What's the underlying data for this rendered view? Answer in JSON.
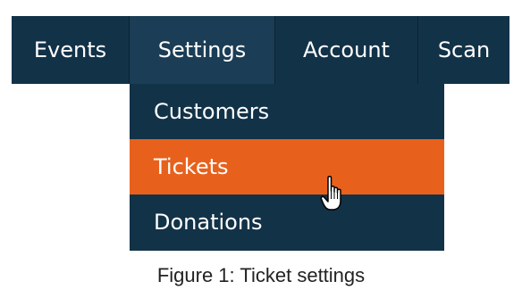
{
  "nav": {
    "items": [
      {
        "label": "Events"
      },
      {
        "label": "Settings"
      },
      {
        "label": "Account"
      },
      {
        "label": "Scan"
      }
    ],
    "active_index": 1
  },
  "dropdown": {
    "items": [
      {
        "label": "Customers"
      },
      {
        "label": "Tickets"
      },
      {
        "label": "Donations"
      }
    ],
    "highlighted_index": 1
  },
  "caption": "Figure 1: Ticket settings",
  "colors": {
    "nav_bg": "#123248",
    "nav_active_bg": "#1b3d55",
    "highlight": "#e8611c",
    "text": "#ffffff"
  },
  "icons": {
    "cursor": "hand-pointer-icon"
  }
}
